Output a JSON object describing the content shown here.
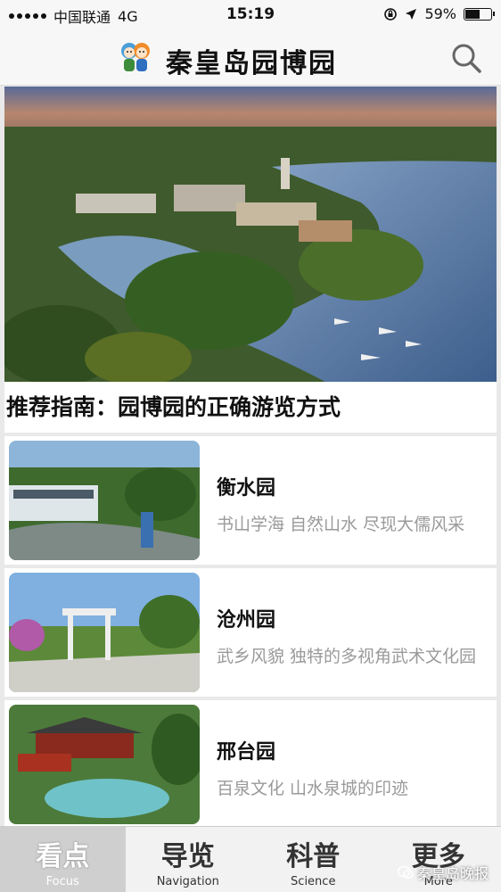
{
  "status": {
    "carrier": "中国联通",
    "network": "4G",
    "time": "15:19",
    "battery_pct": "59%",
    "battery_level": 0.59
  },
  "header": {
    "title": "秦皇岛园博园",
    "logo_icon": "mascot-logo-icon",
    "search_icon": "search-icon"
  },
  "hero": {
    "title": "推荐指南：园博园的正确游览方式"
  },
  "cards": [
    {
      "name": "衡水园",
      "desc": "书山学海 自然山水 尽现大儒风采"
    },
    {
      "name": "沧州园",
      "desc": "武乡风貌 独特的多视角武术文化园"
    },
    {
      "name": "邢台园",
      "desc": "百泉文化 山水泉城的印迹"
    }
  ],
  "tabs": [
    {
      "zh": "看点",
      "en": "Focus"
    },
    {
      "zh": "导览",
      "en": "Navigation"
    },
    {
      "zh": "科普",
      "en": "Science"
    },
    {
      "zh": "更多",
      "en": "More"
    }
  ],
  "watermark": "秦皇岛晚报",
  "colors": {
    "accent_active_tab": "#cfcfcf",
    "desc_gray": "#9a9a9a"
  }
}
